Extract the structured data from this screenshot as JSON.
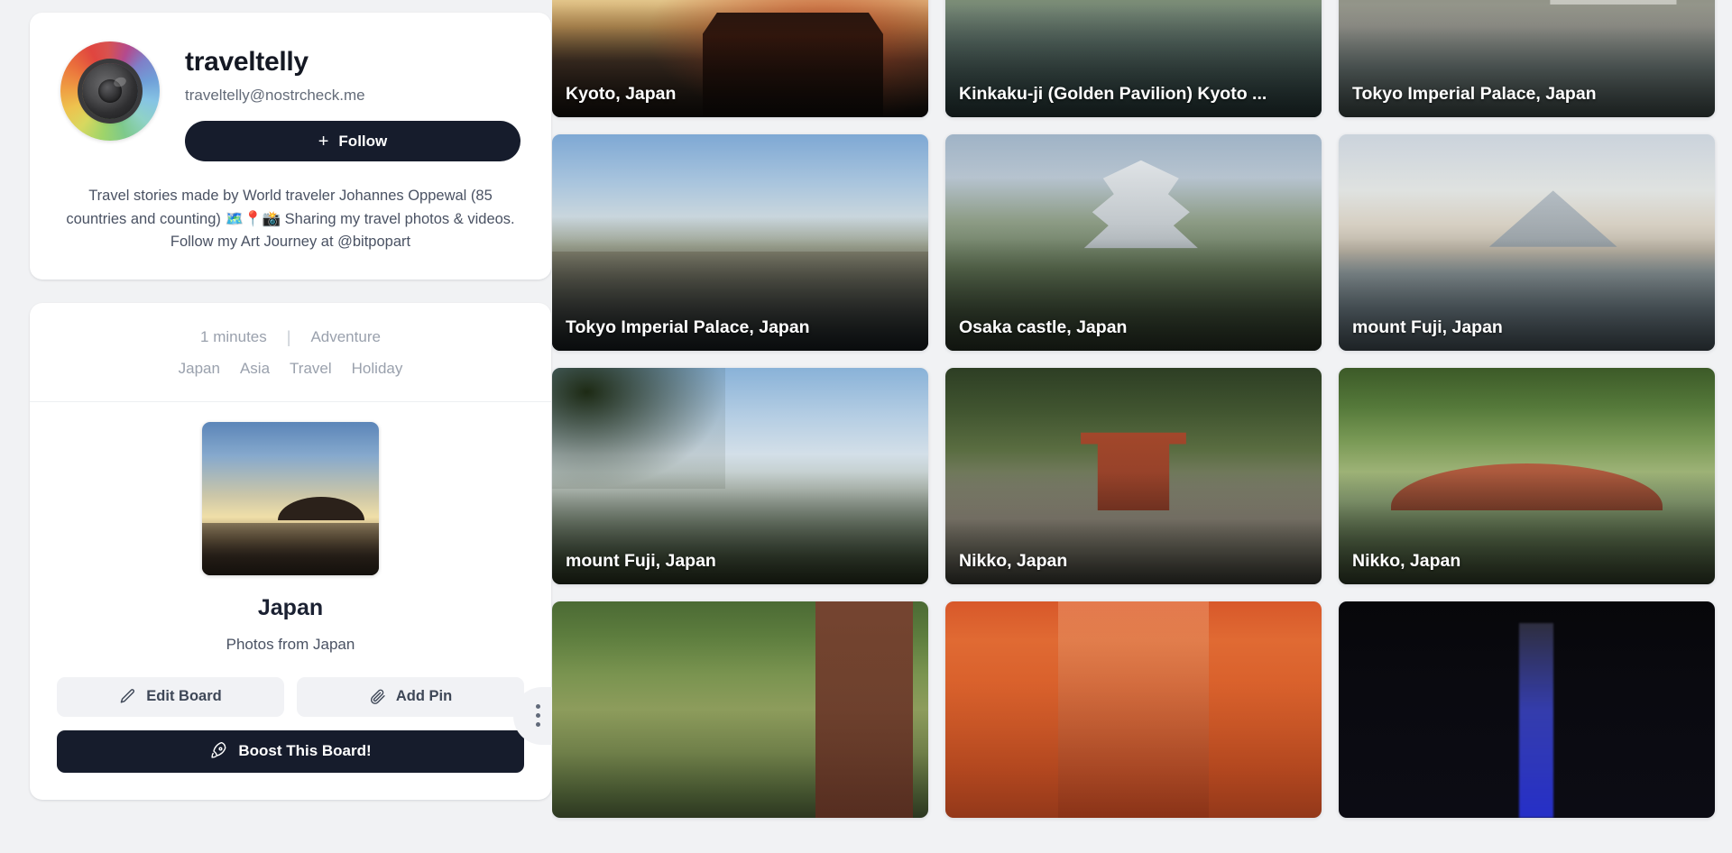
{
  "profile": {
    "username": "traveltelly",
    "handle": "traveltelly@nostrcheck.me",
    "follow_label": "Follow",
    "follow_plus": "+",
    "bio": "Travel stories made by World traveler Johannes Oppewal (85 countries and counting) 🗺️📍📸 Sharing my travel photos & videos. Follow my Art Journey at @bitpopart",
    "avatar_icon": "camera-globe-avatar"
  },
  "board": {
    "read_time": "1 minutes",
    "separator": "|",
    "category": "Adventure",
    "tags": [
      "Japan",
      "Asia",
      "Travel",
      "Holiday"
    ],
    "title": "Japan",
    "subtitle": "Photos from Japan",
    "edit_label": "Edit Board",
    "add_pin_label": "Add Pin",
    "boost_label": "Boost This Board!",
    "menu_icon": "kebab-menu-icon",
    "edit_icon": "pencil-icon",
    "add_pin_icon": "paperclip-icon",
    "boost_icon": "rocket-icon"
  },
  "gallery": {
    "tiles": [
      {
        "caption": "Kyoto, Japan",
        "art": "a-kyoto"
      },
      {
        "caption": "Kinkaku-ji (Golden Pavilion) Kyoto ...",
        "art": "a-kinkaku"
      },
      {
        "caption": "Tokyo Imperial Palace, Japan",
        "art": "a-tokyo1"
      },
      {
        "caption": "Tokyo Imperial Palace, Japan",
        "art": "a-tokyo2"
      },
      {
        "caption": "Osaka castle, Japan",
        "art": "a-osaka"
      },
      {
        "caption": "mount Fuji, Japan",
        "art": "a-fuji1"
      },
      {
        "caption": "mount Fuji, Japan",
        "art": "a-fuji2"
      },
      {
        "caption": "Nikko, Japan",
        "art": "a-nikko1"
      },
      {
        "caption": "Nikko, Japan",
        "art": "a-nikko2"
      },
      {
        "caption": "",
        "art": "a-forest"
      },
      {
        "caption": "",
        "art": "a-torii"
      },
      {
        "caption": "",
        "art": "a-tower"
      }
    ]
  },
  "colors": {
    "page_background": "#f1f2f4",
    "card_background": "#ffffff",
    "accent_dark": "#161c2c",
    "muted_text": "#9aa1ad",
    "body_text": "#4a5263",
    "soft_button": "#f1f2f5"
  }
}
